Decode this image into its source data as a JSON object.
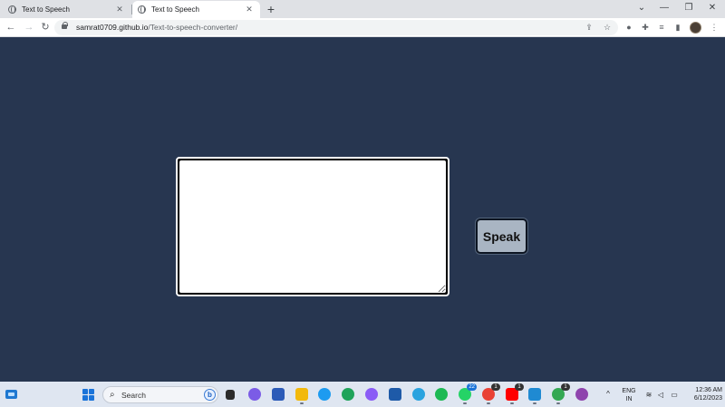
{
  "browser": {
    "tabs": [
      {
        "title": "Text to Speech",
        "active": false
      },
      {
        "title": "Text to Speech",
        "active": true
      }
    ],
    "url_host": "samrat0709.github.io",
    "url_path": "/Text-to-speech-converter/"
  },
  "page": {
    "textarea_value": "",
    "speak_label": "Speak",
    "background_color": "#273650"
  },
  "taskbar": {
    "search_label": "Search",
    "badges": {
      "whatsapp": "22",
      "chrome_profile_a": "1",
      "youtube": "1",
      "chrome_profile_b": "1"
    },
    "language_line1": "ENG",
    "language_line2": "IN",
    "time": "12:36 AM",
    "date": "6/12/2023"
  }
}
